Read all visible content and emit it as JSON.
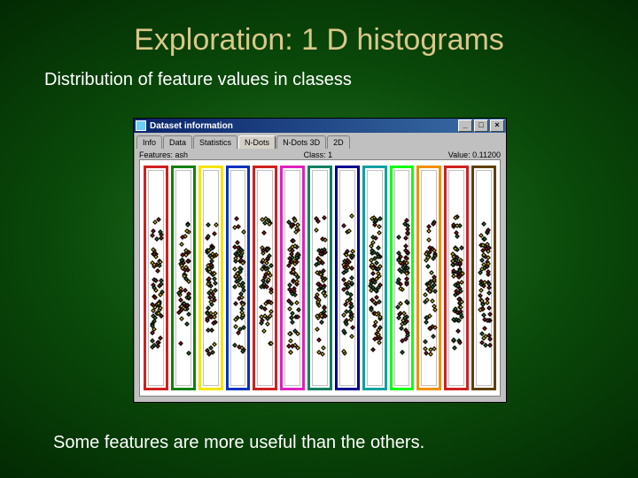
{
  "title": "Exploration: 1 D histograms",
  "subtitle": "Distribution of feature values in clasess",
  "footer": "Some features are more useful than the others.",
  "window": {
    "title": "Dataset information",
    "buttons": {
      "min": "_",
      "max": "□",
      "close": "×"
    },
    "tabs": [
      "Info",
      "Data",
      "Statistics",
      "N-Dots",
      "N-Dots 3D",
      "2D"
    ],
    "active_tab": 3,
    "labels": {
      "features": "Features: ash",
      "class": "Class: 1",
      "value": "Value: 0.11200"
    }
  },
  "strips": [
    {
      "color": "#d02020"
    },
    {
      "color": "#108010"
    },
    {
      "color": "#f5e400"
    },
    {
      "color": "#0030c0"
    },
    {
      "color": "#d02020"
    },
    {
      "color": "#e020c0"
    },
    {
      "color": "#108060"
    },
    {
      "color": "#000090"
    },
    {
      "color": "#10a0a0"
    },
    {
      "color": "#10ff10"
    },
    {
      "color": "#f09000"
    },
    {
      "color": "#d02020"
    },
    {
      "color": "#604000"
    }
  ],
  "dot_colors": [
    "#8b1a1a",
    "#c8b020",
    "#2e6b2e"
  ]
}
